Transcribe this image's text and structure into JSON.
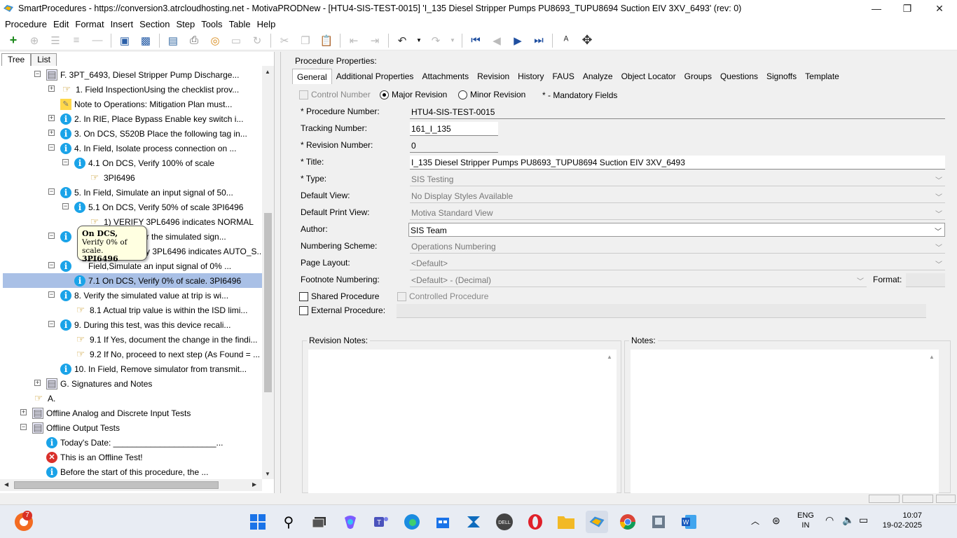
{
  "window": {
    "title": "SmartProcedures - https://conversion3.atrcloudhosting.net - MotivaPRODNew - [HTU4-SIS-TEST-0015] 'I_135 Diesel Stripper Pumps PU8693_TUPU8694 Suction EIV 3XV_6493' (rev: 0)",
    "minimize": "—",
    "maximize": "❐",
    "close": "✕"
  },
  "menu": [
    "Procedure",
    "Edit",
    "Format",
    "Insert",
    "Section",
    "Step",
    "Tools",
    "Table",
    "Help"
  ],
  "left_tabs": [
    "Tree",
    "List"
  ],
  "tree": [
    {
      "text": "F. 3PT_6493, Diesel Stripper Pump Discharge..."
    },
    {
      "text": "1. Field InspectionUsing the checklist prov..."
    },
    {
      "text": "Note to Operations: Mitigation Plan must..."
    },
    {
      "text": "2. In RIE, Place Bypass Enable key switch i..."
    },
    {
      "text": "3. On DCS, S520B Place the following tag in..."
    },
    {
      "text": "4. In Field, Isolate process connection on ..."
    },
    {
      "text": "4.1 On DCS, Verify 100% of scale"
    },
    {
      "text": "3PI6496"
    },
    {
      "text": "5. In Field, Simulate an input signal of 50..."
    },
    {
      "text": "5.1 On DCS, Verify 50% of scale 3PI6496"
    },
    {
      "text": "1) VERIFY 3PL6496 indicates NORMAL"
    },
    {
      "text": "er the simulated sign..."
    },
    {
      "text": "ify 3PL6496  indicates AUTO_S..."
    },
    {
      "text": "Field,Simulate an input signal of 0% ..."
    },
    {
      "text": "7.1 On DCS, Verify 0% of scale. 3PI6496"
    },
    {
      "text": "8. Verify the simulated value at trip is wi..."
    },
    {
      "text": "8.1 Actual trip value is within the ISD limi..."
    },
    {
      "text": "9. During this test, was this device recali..."
    },
    {
      "text": "9.1 If Yes, document the change in the findi..."
    },
    {
      "text": "9.2 If No, proceed to next step (As Found = ..."
    },
    {
      "text": "10. In Field, Remove simulator from transmit..."
    },
    {
      "text": "G. Signatures and Notes"
    },
    {
      "text": "A."
    },
    {
      "text": "Offline Analog and Discrete Input Tests"
    },
    {
      "text": "Offline Output Tests"
    },
    {
      "text": "Today's Date: ______________________..."
    },
    {
      "text": "This is an Offline Test!"
    },
    {
      "text": "Before the start of this procedure, the ..."
    }
  ],
  "tooltip": {
    "line1": "On DCS,",
    "line2": "Verify 0% of scale.",
    "line3": "3PI6496"
  },
  "procedure_properties_label": "Procedure Properties:",
  "tabs": [
    "General",
    "Additional Properties",
    "Attachments",
    "Revision",
    "History",
    "FAUS",
    "Analyze",
    "Object Locator",
    "Groups",
    "Questions",
    "Signoffs",
    "Template"
  ],
  "form": {
    "control_number": "Control Number",
    "major_revision": "Major Revision",
    "minor_revision": "Minor Revision",
    "mandatory_note": "* - Mandatory Fields",
    "procedure_number_label": "* Procedure Number:",
    "procedure_number": "HTU4-SIS-TEST-0015",
    "tracking_number_label": "Tracking Number:",
    "tracking_number": "161_I_135",
    "revision_number_label": "* Revision Number:",
    "revision_number": "0",
    "title_label": "* Title:",
    "title": "I_135 Diesel Stripper Pumps PU8693_TUPU8694 Suction EIV 3XV_6493",
    "type_label": "* Type:",
    "type": "SIS Testing",
    "default_view_label": "Default View:",
    "default_view": "No Display Styles Available",
    "default_print_view_label": "Default Print View:",
    "default_print_view": "Motiva Standard View",
    "author_label": "Author:",
    "author": "SIS Team",
    "numbering_scheme_label": "Numbering Scheme:",
    "numbering_scheme": "Operations Numbering",
    "page_layout_label": "Page Layout:",
    "page_layout": "<Default>",
    "footnote_numbering_label": "Footnote Numbering:",
    "footnote_numbering": "<Default> - (Decimal)",
    "format_label": "Format:",
    "shared_procedure": "Shared Procedure",
    "controlled_procedure": "Controlled Procedure",
    "external_procedure": "External Procedure:",
    "revision_notes_label": "Revision Notes:",
    "notes_label": "Notes:"
  },
  "taskbar": {
    "badge": "7",
    "language": "ENG",
    "region": "IN",
    "time": "10:07",
    "date": "19-02-2025"
  }
}
